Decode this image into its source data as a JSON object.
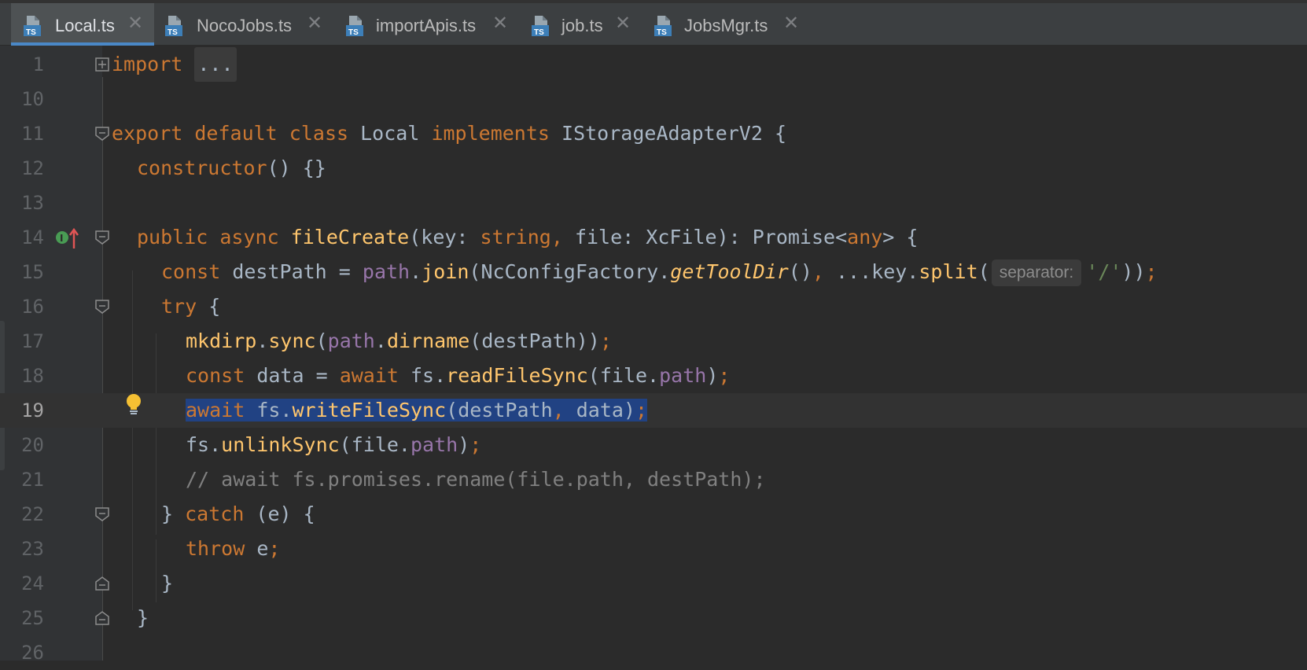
{
  "tabs": [
    {
      "label": "Local.ts",
      "icon": "typescript-file-icon",
      "active": true
    },
    {
      "label": "NocoJobs.ts",
      "icon": "typescript-file-icon",
      "active": false
    },
    {
      "label": "importApis.ts",
      "icon": "typescript-file-icon",
      "active": false
    },
    {
      "label": "job.ts",
      "icon": "typescript-file-icon",
      "active": false
    },
    {
      "label": "JobsMgr.ts",
      "icon": "typescript-file-icon",
      "active": false
    }
  ],
  "tab_icon_text": "TS",
  "tab_close_glyph": "✕",
  "line_numbers": [
    "1",
    "10",
    "11",
    "12",
    "13",
    "14",
    "15",
    "16",
    "17",
    "18",
    "19",
    "20",
    "21",
    "22",
    "23",
    "24",
    "25",
    "26"
  ],
  "current_line": "19",
  "code": {
    "l1": {
      "kw": "import",
      "folded": "..."
    },
    "l11": {
      "kw_export": "export",
      "kw_default": "default",
      "kw_class": "class",
      "name": "Local",
      "kw_implements": "implements",
      "iface": "IStorageAdapterV2",
      "brace": "{"
    },
    "l12": {
      "ctor": "constructor",
      "rest": "() {}"
    },
    "l14": {
      "kw_public": "public",
      "kw_async": "async",
      "fn": "fileCreate",
      "p1": "(key: ",
      "t1": "string",
      "comma": ",",
      "p2": " file: XcFile): Promise<",
      "t2": "any",
      "end": "> {"
    },
    "l15": {
      "kw": "const",
      "a": " destPath = ",
      "path": "path",
      "dot": ".",
      "join": "join",
      "b": "(NcConfigFactory.",
      "tooldir": "getToolDir",
      "c": "()",
      "comma": ",",
      "d": " ...key.",
      "split": "split",
      "e": "(",
      "hint": "separator:",
      "str": "'/'",
      "f": "))",
      "semi": ";"
    },
    "l16": {
      "kw": "try",
      "rest": " {"
    },
    "l17": {
      "mkdirp": "mkdirp",
      "dot": ".",
      "sync": "sync",
      "a": "(",
      "path": "path",
      "dot2": ".",
      "dirname": "dirname",
      "b": "(destPath))",
      "semi": ";"
    },
    "l18": {
      "kw_const": "const",
      "a": " data = ",
      "kw_await": "await",
      "b": " fs.",
      "fn": "readFileSync",
      "c": "(file.",
      "prop": "path",
      "d": ")",
      "semi": ";"
    },
    "l19": {
      "kw_await": "await",
      "a": " fs.",
      "fn": "writeFileSync",
      "b": "(destPath",
      "comma": ",",
      "c": " data)",
      "semi": ";"
    },
    "l20": {
      "a": "fs.",
      "fn": "unlinkSync",
      "b": "(file.",
      "prop": "path",
      "c": ")",
      "semi": ";"
    },
    "l21": {
      "comment": "// await fs.promises.rename(file.path, destPath);"
    },
    "l22": {
      "a": "} ",
      "kw": "catch",
      "b": " (e) {"
    },
    "l23": {
      "kw": "throw",
      "a": " e",
      "semi": ";"
    },
    "l24": {
      "a": "}"
    },
    "l25": {
      "a": "}"
    }
  },
  "gutter": {
    "implements_badge": "I",
    "implements_badge_icon": "implements-method-icon",
    "bulb_icon": "intention-bulb-icon"
  },
  "colors": {
    "keyword": "#cc7832",
    "function": "#ffc66d",
    "property": "#9876aa",
    "string": "#6a8759",
    "comment": "#808080",
    "text": "#a9b7c6",
    "selection": "#214283",
    "ts_icon": "#3d7fb8"
  }
}
